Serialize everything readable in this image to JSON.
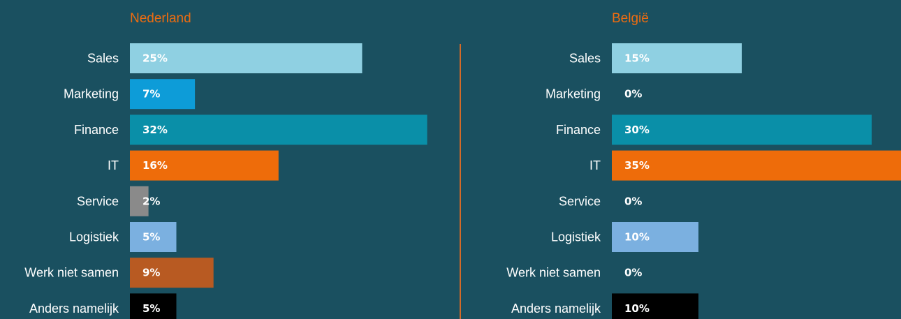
{
  "chart_data": [
    {
      "type": "bar",
      "orientation": "horizontal",
      "title": "Nederland",
      "categories": [
        "Sales",
        "Marketing",
        "Finance",
        "IT",
        "Service",
        "Logistiek",
        "Werk niet samen",
        "Anders namelijk"
      ],
      "values": [
        25,
        7,
        32,
        16,
        2,
        5,
        9,
        5
      ],
      "value_labels": [
        "25%",
        "7%",
        "32%",
        "16%",
        "2%",
        "5%",
        "9%",
        "5%"
      ],
      "unit": "%",
      "grid": false,
      "legend": "none"
    },
    {
      "type": "bar",
      "orientation": "horizontal",
      "title": "België",
      "categories": [
        "Sales",
        "Marketing",
        "Finance",
        "IT",
        "Service",
        "Logistiek",
        "Werk niet samen",
        "Anders namelijk"
      ],
      "values": [
        15,
        0,
        30,
        35,
        0,
        10,
        0,
        10
      ],
      "value_labels": [
        "15%",
        "0%",
        "30%",
        "35%",
        "0%",
        "10%",
        "0%",
        "10%"
      ],
      "unit": "%",
      "grid": false,
      "legend": "none"
    }
  ],
  "colors": {
    "background": "#1a5060",
    "title": "#ee6c10",
    "divider": "#d46a28",
    "categories": [
      "#8fd0e2",
      "#0d9cd8",
      "#0a8fa8",
      "#ee6c0a",
      "#8a8a8a",
      "#7bb0e0",
      "#b85a22",
      "#000000"
    ]
  }
}
